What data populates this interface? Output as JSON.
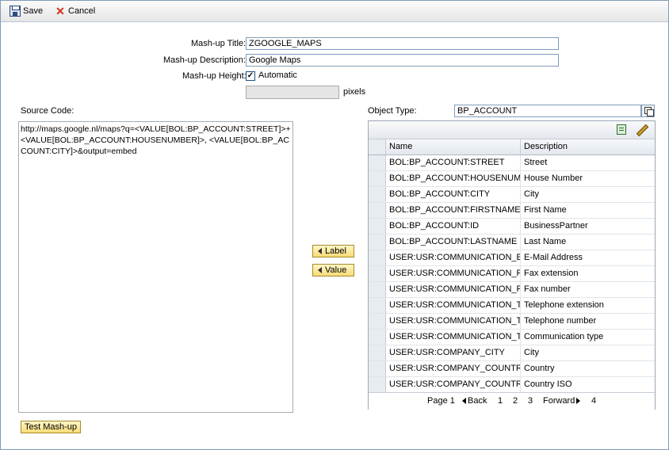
{
  "toolbar": {
    "save_label": "Save",
    "cancel_label": "Cancel"
  },
  "form": {
    "title_label": "Mash-up Title:",
    "title_value": "ZGOOGLE_MAPS",
    "description_label": "Mash-up Description:",
    "description_value": "Google Maps",
    "height_label": "Mash-up Height:",
    "automatic_checked": true,
    "automatic_label": "Automatic",
    "pixels_value": "",
    "pixels_label": "pixels"
  },
  "source": {
    "label": "Source Code:",
    "code": "http://maps.google.nl/maps?q=<VALUE[BOL:BP_ACCOUNT:STREET]>+<VALUE[BOL:BP_ACCOUNT:HOUSENUMBER]>, <VALUE[BOL:BP_ACCOUNT:CITY]>&output=embed"
  },
  "insert_buttons": {
    "label": "Label",
    "value": "Value"
  },
  "object": {
    "label": "Object Type:",
    "value": "BP_ACCOUNT"
  },
  "table": {
    "columns": [
      "Name",
      "Description"
    ],
    "rows": [
      [
        "BOL:BP_ACCOUNT:STREET",
        "Street"
      ],
      [
        "BOL:BP_ACCOUNT:HOUSENUM...",
        "House Number"
      ],
      [
        "BOL:BP_ACCOUNT:CITY",
        "City"
      ],
      [
        "BOL:BP_ACCOUNT:FIRSTNAME",
        "First Name"
      ],
      [
        "BOL:BP_ACCOUNT:ID",
        "BusinessPartner"
      ],
      [
        "BOL:BP_ACCOUNT:LASTNAME",
        "Last Name"
      ],
      [
        "USER:USR:COMMUNICATION_E...",
        "E-Mail Address"
      ],
      [
        "USER:USR:COMMUNICATION_F...",
        "Fax extension"
      ],
      [
        "USER:USR:COMMUNICATION_F...",
        "Fax number"
      ],
      [
        "USER:USR:COMMUNICATION_T...",
        "Telephone extension"
      ],
      [
        "USER:USR:COMMUNICATION_T...",
        "Telephone number"
      ],
      [
        "USER:USR:COMMUNICATION_T...",
        "Communication type"
      ],
      [
        "USER:USR:COMPANY_CITY",
        "City"
      ],
      [
        "USER:USR:COMPANY_COUNTRY",
        "Country"
      ],
      [
        "USER:USR:COMPANY_COUNTR...",
        "Country ISO"
      ]
    ]
  },
  "pager": {
    "page_label": "Page 1",
    "back_label": "Back",
    "pages": [
      "1",
      "2",
      "3"
    ],
    "forward_label": "Forward",
    "last_page": "4"
  },
  "test_button": "Test Mash-up"
}
